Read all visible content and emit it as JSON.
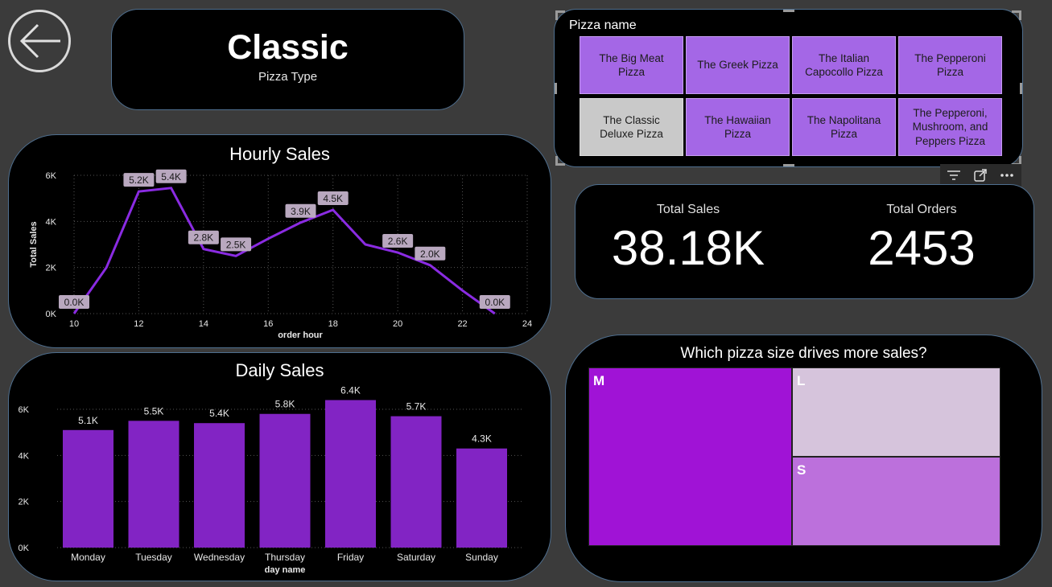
{
  "header": {
    "title": "Classic",
    "subtitle": "Pizza Type"
  },
  "slicer": {
    "label": "Pizza name",
    "items": [
      {
        "label": "The Big Meat Pizza",
        "selected": false
      },
      {
        "label": "The Greek Pizza",
        "selected": false
      },
      {
        "label": "The Italian Capocollo Pizza",
        "selected": false
      },
      {
        "label": "The Pepperoni Pizza",
        "selected": false
      },
      {
        "label": "The Classic Deluxe Pizza",
        "selected": true
      },
      {
        "label": "The Hawaiian Pizza",
        "selected": false
      },
      {
        "label": "The Napolitana Pizza",
        "selected": false
      },
      {
        "label": "The Pepperoni, Mushroom, and Peppers Pizza",
        "selected": false
      }
    ],
    "tools": [
      "filter-icon",
      "focus-mode-icon",
      "more-options-icon"
    ]
  },
  "kpis": {
    "total_sales_label": "Total Sales",
    "total_sales_value": "38.18K",
    "total_orders_label": "Total Orders",
    "total_orders_value": "2453"
  },
  "colors": {
    "accent": "#8a2be2",
    "line": "#8a2be2",
    "bar": "#8224c4",
    "tile": "#a467e6",
    "tile_selected": "#c9c9c9",
    "treemap_m": "#a013d6",
    "treemap_l": "#d6c4dc",
    "treemap_s": "#bc70dc",
    "data_label_bg": "#b9a8bf"
  },
  "chart_data": [
    {
      "type": "line",
      "title": "Hourly Sales",
      "xlabel": "order hour",
      "ylabel": "Total Sales",
      "x": [
        10,
        11,
        12,
        13,
        14,
        15,
        16,
        17,
        18,
        19,
        20,
        21,
        22,
        23
      ],
      "series": [
        {
          "values": [
            0,
            2000,
            5300,
            5450,
            2800,
            2500,
            3250,
            3950,
            4500,
            3000,
            2650,
            2100,
            1000,
            0
          ]
        }
      ],
      "data_labels": [
        {
          "x": 10,
          "text": "0.0K"
        },
        {
          "x": 12,
          "text": "5.2K"
        },
        {
          "x": 13,
          "text": "5.4K"
        },
        {
          "x": 14,
          "text": "2.8K"
        },
        {
          "x": 15,
          "text": "2.5K"
        },
        {
          "x": 17,
          "text": "3.9K"
        },
        {
          "x": 18,
          "text": "4.5K"
        },
        {
          "x": 20,
          "text": "2.6K"
        },
        {
          "x": 21,
          "text": "2.0K"
        },
        {
          "x": 23,
          "text": "0.0K"
        }
      ],
      "xticks": [
        10,
        12,
        14,
        16,
        18,
        20,
        22,
        24
      ],
      "yticks": [
        {
          "v": 0,
          "t": "0K"
        },
        {
          "v": 2000,
          "t": "2K"
        },
        {
          "v": 4000,
          "t": "4K"
        },
        {
          "v": 6000,
          "t": "6K"
        }
      ],
      "xlim": [
        10,
        24
      ],
      "ylim": [
        0,
        6000
      ],
      "grid": true
    },
    {
      "type": "bar",
      "title": "Daily Sales",
      "xlabel": "day name",
      "ylabel": "",
      "categories": [
        "Monday",
        "Tuesday",
        "Wednesday",
        "Thursday",
        "Friday",
        "Saturday",
        "Sunday"
      ],
      "values": [
        5100,
        5500,
        5400,
        5800,
        6400,
        5700,
        4300
      ],
      "data_labels": [
        "5.1K",
        "5.5K",
        "5.4K",
        "5.8K",
        "6.4K",
        "5.7K",
        "4.3K"
      ],
      "yticks": [
        {
          "v": 0,
          "t": "0K"
        },
        {
          "v": 2000,
          "t": "2K"
        },
        {
          "v": 4000,
          "t": "4K"
        },
        {
          "v": 6000,
          "t": "6K"
        }
      ],
      "ylim": [
        0,
        6000
      ],
      "grid": true
    },
    {
      "type": "treemap",
      "title": "Which pizza size drives more sales?",
      "items": [
        {
          "name": "M",
          "share": 0.495
        },
        {
          "name": "L",
          "share": 0.253
        },
        {
          "name": "S",
          "share": 0.252
        }
      ]
    }
  ]
}
